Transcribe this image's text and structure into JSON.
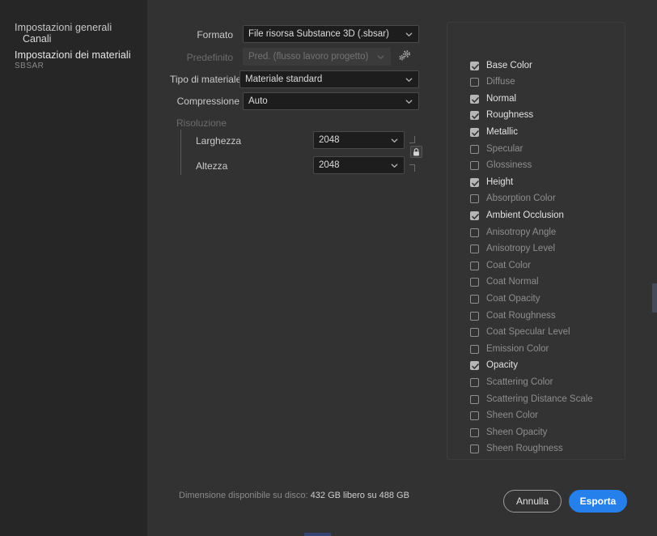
{
  "sidebar": {
    "items": [
      {
        "label": "Impostazioni generali",
        "sub": null,
        "active": false
      },
      {
        "label": "Impostazioni dei materiali",
        "sub": "SBSAR",
        "active": true
      }
    ]
  },
  "form": {
    "format": {
      "label": "Formato",
      "value": "File risorsa Substance 3D (.sbsar)"
    },
    "preset": {
      "label": "Predefinito",
      "value": "Pred. (flusso lavoro progetto)",
      "disabled": true,
      "gear_icon": "gear-icon"
    },
    "material_type": {
      "label": "Tipo di materiale",
      "value": "Materiale standard"
    },
    "compression": {
      "label": "Compressione",
      "value": "Auto"
    },
    "resolution": {
      "label": "Risoluzione",
      "width": {
        "label": "Larghezza",
        "value": "2048"
      },
      "height": {
        "label": "Altezza",
        "value": "2048"
      },
      "link_icon": "lock-icon",
      "linked": true
    }
  },
  "channels": {
    "title": "Canali",
    "items": [
      {
        "label": "Base Color",
        "checked": true
      },
      {
        "label": "Diffuse",
        "checked": false
      },
      {
        "label": "Normal",
        "checked": true
      },
      {
        "label": "Roughness",
        "checked": true
      },
      {
        "label": "Metallic",
        "checked": true
      },
      {
        "label": "Specular",
        "checked": false
      },
      {
        "label": "Glossiness",
        "checked": false
      },
      {
        "label": "Height",
        "checked": true
      },
      {
        "label": "Absorption Color",
        "checked": false
      },
      {
        "label": "Ambient Occlusion",
        "checked": true
      },
      {
        "label": "Anisotropy Angle",
        "checked": false
      },
      {
        "label": "Anisotropy Level",
        "checked": false
      },
      {
        "label": "Coat Color",
        "checked": false
      },
      {
        "label": "Coat Normal",
        "checked": false
      },
      {
        "label": "Coat Opacity",
        "checked": false
      },
      {
        "label": "Coat Roughness",
        "checked": false
      },
      {
        "label": "Coat Specular Level",
        "checked": false
      },
      {
        "label": "Emission Color",
        "checked": false
      },
      {
        "label": "Opacity",
        "checked": true
      },
      {
        "label": "Scattering Color",
        "checked": false
      },
      {
        "label": "Scattering Distance Scale",
        "checked": false
      },
      {
        "label": "Sheen Color",
        "checked": false
      },
      {
        "label": "Sheen Opacity",
        "checked": false
      },
      {
        "label": "Sheen Roughness",
        "checked": false
      }
    ]
  },
  "footer": {
    "disk_label": "Dimensione disponibile su disco:",
    "disk_value": "432 GB libero su 488 GB",
    "cancel_label": "Annulla",
    "export_label": "Esporta"
  },
  "colors": {
    "accent": "#2680eb",
    "sidebar_bg": "#262626",
    "main_bg": "#323232",
    "panel_bg": "#333333",
    "field_bg": "#1d1d1d"
  }
}
